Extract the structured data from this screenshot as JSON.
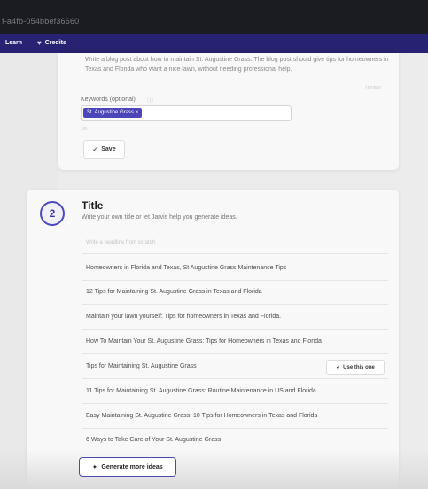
{
  "topbar": {
    "id_text": "f-a4fb-054bbef36660"
  },
  "nav": {
    "learn": "Learn",
    "credits_icon": "heart-icon",
    "credits": "Credits"
  },
  "description": {
    "text": "Write a blog post about how to maintain St. Augustine Grass. The blog post should give tips for homeowners in Texas and Florida who want a nice lawn, without needing professional help.",
    "char_count": "162/600"
  },
  "keywords": {
    "label": "Keywords (optional)",
    "info_icon": "info-icon",
    "chips": [
      "St. Augustine Grass ×"
    ],
    "note": "1/6"
  },
  "save": {
    "label": "Save",
    "icon": "check-icon"
  },
  "step2": {
    "number": "2",
    "heading": "Title",
    "subheading": "Write your own title or let Jarvis help you generate ideas.",
    "placeholder": "Write a headline from scratch",
    "ideas": [
      "Homeowners in Florida and Texas, St Augustine Grass Maintenance Tips",
      "12 Tips for Maintaining St. Augustine Grass in Texas and Florida",
      "Maintain your lawn yourself: Tips for homeowners in Texas and Florida.",
      "How To Maintain Your St. Augustine Grass: Tips for Homeowners in Texas and Florida",
      "Tips for Maintaining St. Augustine Grass",
      "11 Tips for Maintaining St. Augustine Grass: Routine Maintenance in US and Florida",
      "Easy Maintaining St. Augustine Grass: 10 Tips for Homeowners in Texas and Florida",
      "6 Ways to Take Care of Your St. Augustine Grass"
    ],
    "use_button": "Use this one",
    "generate_button": "Generate more ideas",
    "generate_icon": "sparkle-icon"
  },
  "colors": {
    "nav_bg": "#272271",
    "accent": "#4d46b8",
    "topbar_bg": "#1b1b22"
  }
}
